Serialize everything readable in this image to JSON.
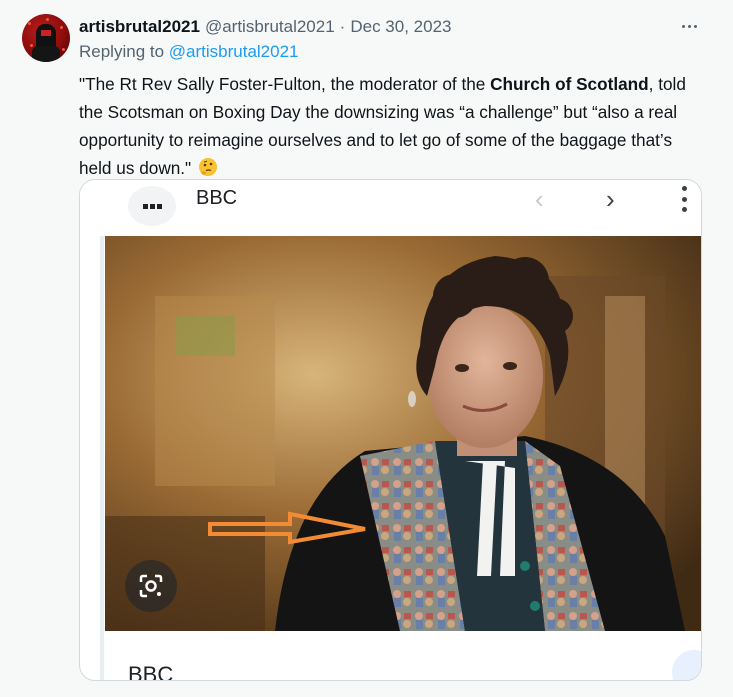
{
  "tweet": {
    "display_name": "artisbrutal2021",
    "handle": "@artisbrutal2021",
    "separator": "·",
    "date": "Dec 30, 2023",
    "replying_prefix": "Replying to ",
    "replying_handle": "@artisbrutal2021",
    "text_part1": "\"The Rt Rev Sally Foster-Fulton, the moderator of the ",
    "text_bold": "Church of Scotland",
    "text_part2": ", told the Scotsman on Boxing Day the downsizing was “a challenge” but “also a real opportunity to reimagine ourselves and to let go of some of the baggage that’s held us down.\"",
    "emoji": "thinking-face"
  },
  "media": {
    "site_name": "BBC",
    "caption": "BBC",
    "icons": {
      "tabs": "tab-switcher-icon",
      "back": "chevron-left-icon",
      "forward": "chevron-right-icon",
      "menu": "vertical-dots-icon",
      "lens": "google-lens-icon"
    },
    "annotation": "orange-arrow",
    "accent_color": "#f28b33"
  },
  "colors": {
    "link": "#1d9bf0",
    "secondary_text": "#536471",
    "background": "#f7f9f9"
  }
}
